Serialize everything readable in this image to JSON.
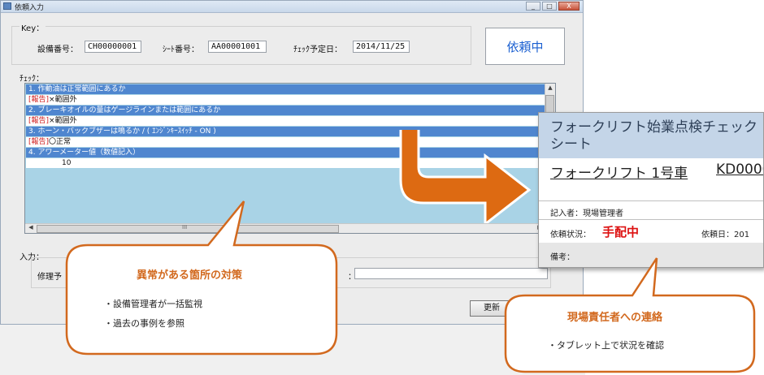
{
  "window": {
    "title": "依頼入力",
    "buttons": [
      "_",
      "□",
      "X"
    ]
  },
  "key": {
    "group_label": "Key：",
    "equipment_label": "設備番号：",
    "equipment_value": "CH00000001",
    "sheet_label": "ｼｰﾄ番号：",
    "sheet_value": "AA00001001",
    "date_label": "ﾁｪｯｸ予定日：",
    "date_value": "2014/11/25"
  },
  "status": {
    "label": "依頼中",
    "color": "#1a5fd0"
  },
  "check": {
    "label": "ﾁｪｯｸ：",
    "items": [
      {
        "question": "1. 作動油は正常範囲にあるか",
        "tag": "[報告]",
        "answer": "×範囲外"
      },
      {
        "question": "2. ブレーキオイルの量はゲージラインまたは範囲にあるか",
        "tag": "[報告]",
        "answer": "×範囲外"
      },
      {
        "question": "3. ホーン・バックブザーは鳴るか /  ( ｴﾝｼﾞﾝｷｰｽｲｯﾁ - ON )",
        "tag": "[報告]",
        "answer": "〇正常"
      },
      {
        "question": "4. アワーメーター値（数値記入）",
        "tag": "",
        "answer": "10"
      }
    ],
    "header_color": "#4f86cf",
    "panel_color": "#a9d3e6",
    "scroll_marker": "III"
  },
  "input": {
    "label": "入力：",
    "repair_label": "修理予",
    "colon": "："
  },
  "update_button": "更新",
  "tablet": {
    "title": "フォークリフト始業点検チェック\nシート",
    "subtitle": "フォークリフト 1号車",
    "id_partial": "KD0000",
    "writer": "記入者：現場管理者",
    "status_label": "依頼状況：",
    "status_value": "手配中",
    "date_label": "依頼日：201",
    "remarks_label": "備考："
  },
  "callout_left": {
    "title": "異常がある箇所の対策",
    "items": [
      "・設備管理者が一括監視",
      "・過去の事例を参照"
    ]
  },
  "callout_right": {
    "title": "現場責任者への連絡",
    "items": [
      "・タブレット上で状況を確認"
    ]
  },
  "colors": {
    "accent_orange": "#d2691e",
    "arrow_orange": "#dd6a12"
  }
}
